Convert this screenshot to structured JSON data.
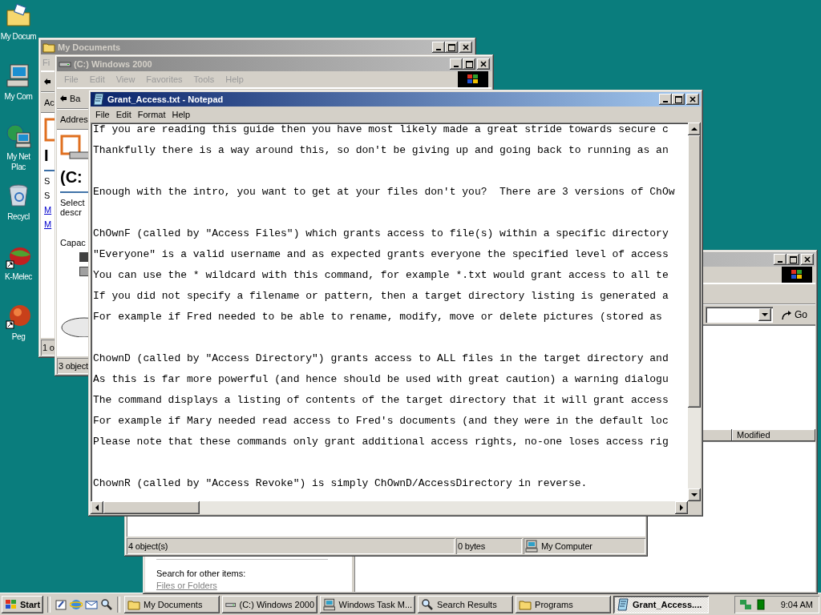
{
  "desktop_icons": [
    {
      "kind": "documents",
      "label": [
        "My Docum"
      ]
    },
    {
      "kind": "computer",
      "label": [
        "My Com"
      ]
    },
    {
      "kind": "network",
      "label": [
        "My Net",
        "Plac"
      ]
    },
    {
      "kind": "recycle",
      "label": [
        "Recycl"
      ]
    },
    {
      "kind": "browser",
      "label": [
        "K-Melec"
      ]
    },
    {
      "kind": "mail",
      "label": [
        "Peg"
      ]
    }
  ],
  "my_documents_window": {
    "title": "My Documents",
    "active": false,
    "menu": "Fi",
    "address_label": "Ac",
    "heading": "I",
    "panel": [
      "S",
      "S"
    ],
    "links": [
      "M",
      "M"
    ],
    "status": "1 o"
  },
  "drive_window": {
    "title": "(C:) Windows 2000",
    "active": false,
    "menu": [
      "File",
      "Edit",
      "View",
      "Favorites",
      "Tools",
      "Help"
    ],
    "back": "Ba",
    "address_label": "Addres",
    "heading": "(C:",
    "description": [
      "Select",
      "descr"
    ],
    "capacity": "Capac",
    "status": "3 object"
  },
  "search_window": {
    "active": false,
    "go": "Go",
    "columns": [
      "Modified"
    ],
    "side_heading": "Search for other items:",
    "side_link": "Files or Folders"
  },
  "programs_window": {
    "status": [
      "4 object(s)",
      "0 bytes"
    ],
    "location": "My Computer"
  },
  "notepad": {
    "title": "Grant_Access.txt - Notepad",
    "active": true,
    "menu": [
      "File",
      "Edit",
      "Format",
      "Help"
    ],
    "paragraphs": [
      [
        "If you are reading this guide then you have most likely made a great stride towards secure c",
        "Thankfully there is a way around this, so don't be giving up and going back to running as an"
      ],
      [
        "Enough with the intro, you want to get at your files don't you?  There are 3 versions of ChOw"
      ],
      [
        "ChOwnF (called by \"Access Files\") which grants access to file(s) within a specific directory",
        "\"Everyone\" is a valid username and as expected grants everyone the specified level of access",
        "You can use the * wildcard with this command, for example *.txt would grant access to all te",
        "If you did not specify a filename or pattern, then a target directory listing is generated a",
        "For example if Fred needed to be able to rename, modify, move or delete pictures (stored as"
      ],
      [
        "ChownD (called by \"Access Directory\") grants access to ALL files in the target directory and",
        "As this is far more powerful (and hence should be used with great caution) a warning dialogu",
        "The command displays a listing of contents of the target directory that it will grant access",
        "For example if Mary needed read access to Fred's documents (and they were in the default loc",
        "Please note that these commands only grant additional access rights, no-one loses access rig"
      ],
      [
        "ChownR (called by \"Access Revoke\") is simply ChOwnD/AccessDirectory in reverse."
      ]
    ]
  },
  "taskbar": {
    "start": "Start",
    "buttons": [
      {
        "kind": "folder",
        "label": "My Documents",
        "selected": false
      },
      {
        "kind": "drive",
        "label": "(C:) Windows 2000",
        "selected": false
      },
      {
        "kind": "monitor",
        "label": "Windows Task M...",
        "selected": false
      },
      {
        "kind": "search",
        "label": "Search Results",
        "selected": false
      },
      {
        "kind": "folder",
        "label": "Programs",
        "selected": false
      },
      {
        "kind": "notepad",
        "label": "Grant_Access....",
        "selected": true
      }
    ],
    "clock": "9:04 AM"
  }
}
